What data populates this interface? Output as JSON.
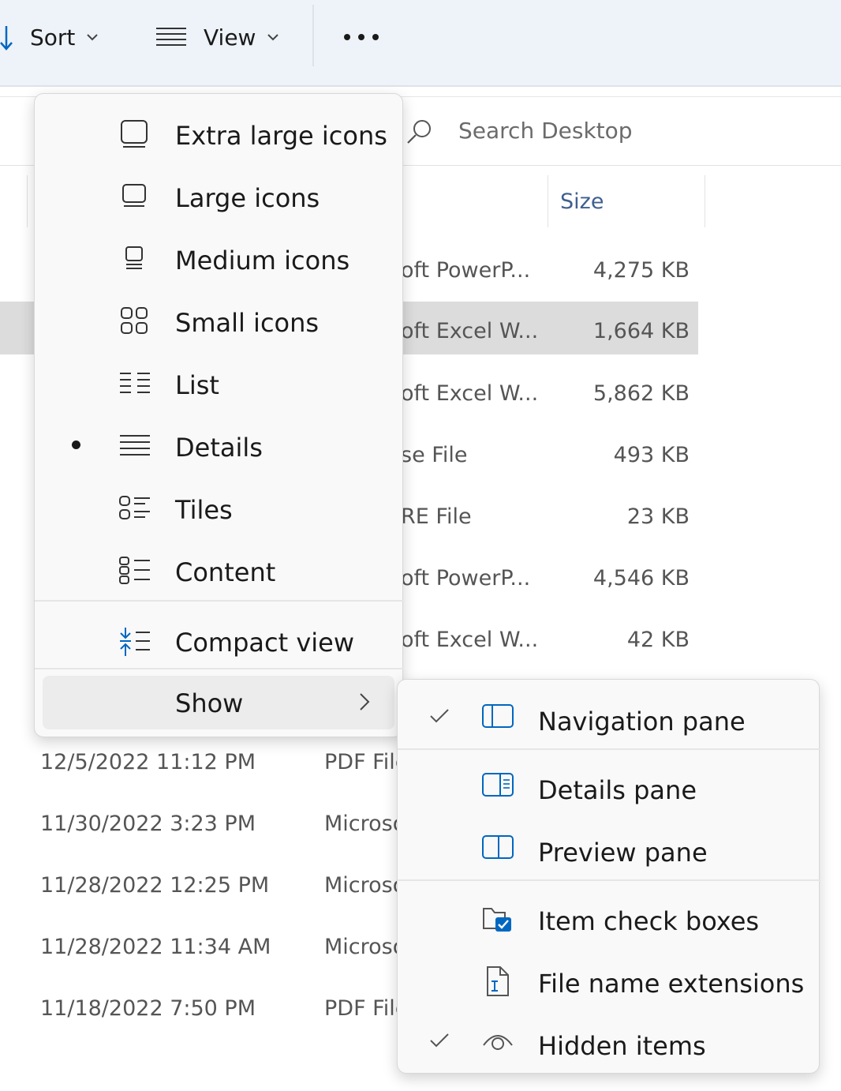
{
  "toolbar": {
    "sort_label": "Sort",
    "view_label": "View",
    "more_label": "•••"
  },
  "search": {
    "placeholder": "Search Desktop"
  },
  "columns": {
    "size": "Size"
  },
  "files": [
    {
      "type": "oft PowerP...",
      "size": "4,275 KB",
      "selected": false
    },
    {
      "type": "oft Excel W...",
      "size": "1,664 KB",
      "selected": true
    },
    {
      "type": "oft Excel W...",
      "size": "5,862 KB",
      "selected": false
    },
    {
      "type": "se File",
      "size": "493 KB",
      "selected": false
    },
    {
      "type": "RE File",
      "size": "23 KB",
      "selected": false
    },
    {
      "type": "oft PowerP...",
      "size": "4,546 KB",
      "selected": false
    },
    {
      "type": "oft Excel W...",
      "size": "42 KB",
      "selected": false
    }
  ],
  "lower_files": [
    {
      "date": "12/5/2022 11:12 PM",
      "type": "PDF File"
    },
    {
      "date": "11/30/2022 3:23 PM",
      "type": "Microsoft"
    },
    {
      "date": "11/28/2022 12:25 PM",
      "type": "Microsoft"
    },
    {
      "date": "11/28/2022 11:34 AM",
      "type": "Microsoft"
    },
    {
      "date": "11/18/2022 7:50 PM",
      "type": "PDF File"
    }
  ],
  "view_menu": {
    "items": [
      {
        "label": "Extra large icons",
        "icon": "extra-large-icons-icon"
      },
      {
        "label": "Large icons",
        "icon": "large-icons-icon"
      },
      {
        "label": "Medium icons",
        "icon": "medium-icons-icon"
      },
      {
        "label": "Small icons",
        "icon": "small-icons-icon"
      },
      {
        "label": "List",
        "icon": "list-icon"
      },
      {
        "label": "Details",
        "icon": "details-icon",
        "selected": true
      },
      {
        "label": "Tiles",
        "icon": "tiles-icon"
      },
      {
        "label": "Content",
        "icon": "content-icon"
      }
    ],
    "compact_label": "Compact view",
    "show_label": "Show"
  },
  "show_menu": {
    "items": [
      {
        "label": "Navigation pane",
        "checked": true,
        "icon": "navigation-pane-icon"
      },
      {
        "label": "Details pane",
        "checked": false,
        "icon": "details-pane-icon"
      },
      {
        "label": "Preview pane",
        "checked": false,
        "icon": "preview-pane-icon"
      },
      {
        "label": "Item check boxes",
        "checked": false,
        "icon": "item-check-boxes-icon"
      },
      {
        "label": "File name extensions",
        "checked": false,
        "icon": "file-name-extensions-icon"
      },
      {
        "label": "Hidden items",
        "checked": true,
        "icon": "hidden-items-icon"
      }
    ]
  },
  "colors": {
    "accent": "#0067c0",
    "toolbar_bg": "#eef3f9",
    "selected_row": "#dcdcdc"
  }
}
